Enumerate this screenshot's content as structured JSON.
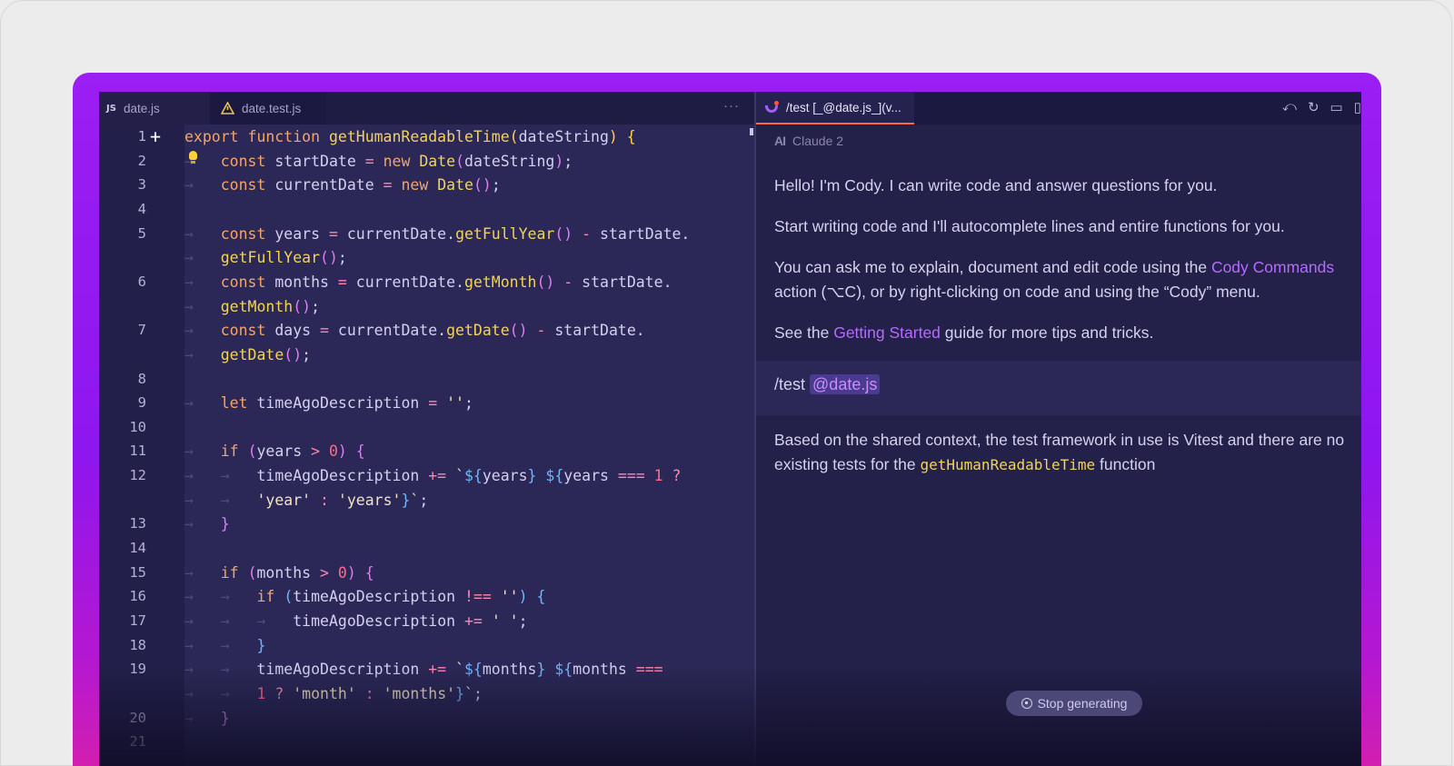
{
  "editor": {
    "tabs": [
      {
        "label": "date.js",
        "badge": "JS"
      },
      {
        "label": "date.test.js"
      }
    ],
    "more": "···",
    "lines": [
      {
        "num": "1",
        "tokens": [
          [
            "k",
            "export "
          ],
          [
            "k",
            "function "
          ],
          [
            "f",
            "getHumanReadableTime"
          ],
          [
            "b1",
            "("
          ],
          [
            "p",
            "dateString"
          ],
          [
            "b1",
            ")"
          ],
          [
            "p",
            " "
          ],
          [
            "b1",
            "{"
          ]
        ]
      },
      {
        "num": "2",
        "indent": 1,
        "tokens": [
          [
            "k",
            "const "
          ],
          [
            "p",
            "startDate "
          ],
          [
            "op",
            "= "
          ],
          [
            "k",
            "new "
          ],
          [
            "f",
            "Date"
          ],
          [
            "b2",
            "("
          ],
          [
            "p",
            "dateString"
          ],
          [
            "b2",
            ")"
          ],
          [
            "p",
            ";"
          ]
        ]
      },
      {
        "num": "3",
        "indent": 1,
        "tokens": [
          [
            "k",
            "const "
          ],
          [
            "p",
            "currentDate "
          ],
          [
            "op",
            "= "
          ],
          [
            "k",
            "new "
          ],
          [
            "f",
            "Date"
          ],
          [
            "b2",
            "()"
          ],
          [
            "p",
            ";"
          ]
        ]
      },
      {
        "num": "4",
        "tokens": []
      },
      {
        "num": "5",
        "indent": 1,
        "tokens": [
          [
            "k",
            "const "
          ],
          [
            "p",
            "years "
          ],
          [
            "op",
            "= "
          ],
          [
            "p",
            "currentDate."
          ],
          [
            "f",
            "getFullYear"
          ],
          [
            "b2",
            "()"
          ],
          [
            "p",
            " "
          ],
          [
            "op",
            "- "
          ],
          [
            "p",
            "startDate."
          ]
        ]
      },
      {
        "num": "",
        "indent": 1,
        "tokens": [
          [
            "f",
            "getFullYear"
          ],
          [
            "b2",
            "()"
          ],
          [
            "p",
            ";"
          ]
        ]
      },
      {
        "num": "6",
        "indent": 1,
        "tokens": [
          [
            "k",
            "const "
          ],
          [
            "p",
            "months "
          ],
          [
            "op",
            "= "
          ],
          [
            "p",
            "currentDate."
          ],
          [
            "f",
            "getMonth"
          ],
          [
            "b2",
            "()"
          ],
          [
            "p",
            " "
          ],
          [
            "op",
            "- "
          ],
          [
            "p",
            "startDate."
          ]
        ]
      },
      {
        "num": "",
        "indent": 1,
        "tokens": [
          [
            "f",
            "getMonth"
          ],
          [
            "b2",
            "()"
          ],
          [
            "p",
            ";"
          ]
        ]
      },
      {
        "num": "7",
        "indent": 1,
        "tokens": [
          [
            "k",
            "const "
          ],
          [
            "p",
            "days "
          ],
          [
            "op",
            "= "
          ],
          [
            "p",
            "currentDate."
          ],
          [
            "f",
            "getDate"
          ],
          [
            "b2",
            "()"
          ],
          [
            "p",
            " "
          ],
          [
            "op",
            "- "
          ],
          [
            "p",
            "startDate."
          ]
        ]
      },
      {
        "num": "",
        "indent": 1,
        "tokens": [
          [
            "f",
            "getDate"
          ],
          [
            "b2",
            "()"
          ],
          [
            "p",
            ";"
          ]
        ]
      },
      {
        "num": "8",
        "tokens": []
      },
      {
        "num": "9",
        "indent": 1,
        "tokens": [
          [
            "k",
            "let "
          ],
          [
            "p",
            "timeAgoDescription "
          ],
          [
            "op",
            "= "
          ],
          [
            "s",
            "''"
          ],
          [
            "p",
            ";"
          ]
        ]
      },
      {
        "num": "10",
        "tokens": []
      },
      {
        "num": "11",
        "indent": 1,
        "tokens": [
          [
            "k",
            "if "
          ],
          [
            "b2",
            "("
          ],
          [
            "p",
            "years "
          ],
          [
            "op",
            "> "
          ],
          [
            "n",
            "0"
          ],
          [
            "b2",
            ")"
          ],
          [
            "p",
            " "
          ],
          [
            "b2",
            "{"
          ]
        ]
      },
      {
        "num": "12",
        "indent": 2,
        "tokens": [
          [
            "p",
            "timeAgoDescription "
          ],
          [
            "op",
            "+= "
          ],
          [
            "s",
            "`"
          ],
          [
            "b3",
            "${"
          ],
          [
            "p",
            "years"
          ],
          [
            "b3",
            "}"
          ],
          [
            "s",
            " "
          ],
          [
            "b3",
            "${"
          ],
          [
            "p",
            "years "
          ],
          [
            "op",
            "=== "
          ],
          [
            "n",
            "1 "
          ],
          [
            "op",
            "?"
          ]
        ]
      },
      {
        "num": "",
        "indent": 2,
        "tokens": [
          [
            "s",
            "'year' "
          ],
          [
            "op",
            ": "
          ],
          [
            "s",
            "'years'"
          ],
          [
            "b3",
            "}"
          ],
          [
            "s",
            "`"
          ],
          [
            "p",
            ";"
          ]
        ]
      },
      {
        "num": "13",
        "indent": 1,
        "tokens": [
          [
            "b2",
            "}"
          ]
        ]
      },
      {
        "num": "14",
        "tokens": []
      },
      {
        "num": "15",
        "indent": 1,
        "tokens": [
          [
            "k",
            "if "
          ],
          [
            "b2",
            "("
          ],
          [
            "p",
            "months "
          ],
          [
            "op",
            "> "
          ],
          [
            "n",
            "0"
          ],
          [
            "b2",
            ")"
          ],
          [
            "p",
            " "
          ],
          [
            "b2",
            "{"
          ]
        ]
      },
      {
        "num": "16",
        "indent": 2,
        "tokens": [
          [
            "k",
            "if "
          ],
          [
            "b3",
            "("
          ],
          [
            "p",
            "timeAgoDescription "
          ],
          [
            "op",
            "!== "
          ],
          [
            "s",
            "''"
          ],
          [
            "b3",
            ")"
          ],
          [
            "p",
            " "
          ],
          [
            "b3",
            "{"
          ]
        ]
      },
      {
        "num": "17",
        "indent": 3,
        "tokens": [
          [
            "p",
            "timeAgoDescription "
          ],
          [
            "op",
            "+= "
          ],
          [
            "s",
            "' '"
          ],
          [
            "p",
            ";"
          ]
        ]
      },
      {
        "num": "18",
        "indent": 2,
        "tokens": [
          [
            "b3",
            "}"
          ]
        ]
      },
      {
        "num": "19",
        "indent": 2,
        "tokens": [
          [
            "p",
            "timeAgoDescription "
          ],
          [
            "op",
            "+= "
          ],
          [
            "s",
            "`"
          ],
          [
            "b3",
            "${"
          ],
          [
            "p",
            "months"
          ],
          [
            "b3",
            "}"
          ],
          [
            "s",
            " "
          ],
          [
            "b3",
            "${"
          ],
          [
            "p",
            "months "
          ],
          [
            "op",
            "==="
          ]
        ]
      },
      {
        "num": "",
        "indent": 2,
        "tokens": [
          [
            "n",
            "1 "
          ],
          [
            "op",
            "? "
          ],
          [
            "s",
            "'month' "
          ],
          [
            "op",
            ": "
          ],
          [
            "s",
            "'months'"
          ],
          [
            "b3",
            "}"
          ],
          [
            "s",
            "`"
          ],
          [
            "p",
            ";"
          ]
        ]
      },
      {
        "num": "20",
        "indent": 1,
        "tokens": [
          [
            "b2",
            "}"
          ]
        ]
      },
      {
        "num": "21",
        "tokens": []
      }
    ]
  },
  "chat": {
    "tab_label": "/test [_@date.js_](v...",
    "model": "Claude 2",
    "model_icon": "AI",
    "greeting": "Hello! I'm Cody. I can write code and answer questions for you.",
    "intro": "Start writing code and I'll autocomplete lines and entire functions for you.",
    "ask_pre": "You can ask me to explain, document and edit code using the ",
    "ask_link": "Cody Commands",
    "ask_line2": "action (⌥C), or by right-clicking on code and using the “Cody” menu.",
    "see_pre": "See the ",
    "see_link": "Getting Started",
    "see_post": " guide for more tips and tricks.",
    "user_command": "/test",
    "user_mention": "@date.js",
    "reply_line1": "Based on the shared context, the test framework in use is Vitest and there are no",
    "reply_line2_pre": "existing tests for the ",
    "reply_code": "getHumanReadableTime",
    "reply_line2_post": " function",
    "stop_label": "Stop generating"
  },
  "colors": {
    "frame_top": "#9b1ef3",
    "frame_bottom": "#d21fb0",
    "accent_link": "#b46cff"
  }
}
